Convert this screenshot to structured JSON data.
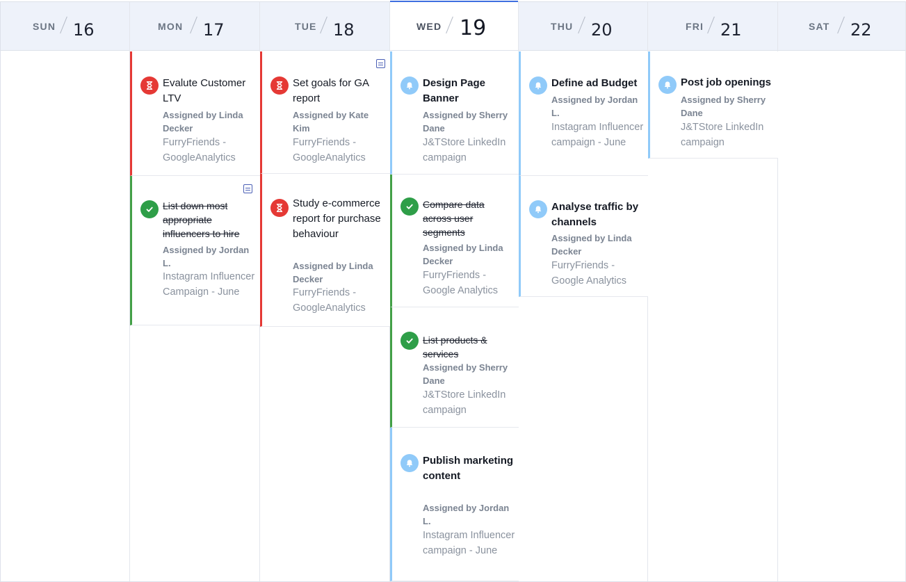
{
  "colors": {
    "overdue": "#e53935",
    "done": "#43a047",
    "reminder": "#90caf9",
    "today_accent": "#3f6fe0"
  },
  "days": [
    {
      "dow": "SUN",
      "num": "16"
    },
    {
      "dow": "MON",
      "num": "17"
    },
    {
      "dow": "TUE",
      "num": "18"
    },
    {
      "dow": "WED",
      "num": "19"
    },
    {
      "dow": "THU",
      "num": "20"
    },
    {
      "dow": "FRI",
      "num": "21"
    },
    {
      "dow": "SAT",
      "num": "22"
    }
  ],
  "tasks": {
    "mon_1": {
      "title": "Evalute Customer LTV",
      "assigned": "Assigned by Linda Decker",
      "project": "FurryFriends - GoogleAnalytics",
      "status": "overdue",
      "icon": "hourglass-icon"
    },
    "mon_2": {
      "title": "List down most appropriate influencers to hire",
      "assigned": "Assigned by Jordan L.",
      "project": "Instagram Influencer Campaign - June",
      "status": "done",
      "icon": "check-icon",
      "has_note": true
    },
    "tue_1": {
      "title": "Set goals for GA report",
      "assigned": "Assigned by Kate Kim",
      "project": "FurryFriends - GoogleAnalytics",
      "status": "overdue",
      "icon": "hourglass-icon",
      "has_note": true
    },
    "tue_2": {
      "title": "Study e-commerce report for purchase behaviour",
      "assigned": "Assigned by Linda Decker",
      "project": "FurryFriends - GoogleAnalytics",
      "status": "overdue",
      "icon": "hourglass-icon"
    },
    "wed_1": {
      "title": "Design Page Banner",
      "assigned": "Assigned by Sherry Dane",
      "project": "J&TStore LinkedIn campaign",
      "status": "reminder",
      "icon": "bell-icon"
    },
    "wed_2": {
      "title": "Compare data across user segments",
      "assigned": "Assigned by Linda Decker",
      "project": "FurryFriends - Google Analytics",
      "status": "done",
      "icon": "check-icon"
    },
    "wed_3": {
      "title": "List products & services",
      "assigned": "Assigned by Sherry Dane",
      "project": "J&TStore LinkedIn campaign",
      "status": "done",
      "icon": "check-icon"
    },
    "wed_4": {
      "title": "Publish marketing content",
      "assigned": "Assigned by Jordan L.",
      "project": "Instagram Influencer campaign - June",
      "status": "reminder",
      "icon": "bell-icon"
    },
    "thu_1": {
      "title": "Define ad Budget",
      "assigned": "Assigned by Jordan L.",
      "project": "Instagram Influencer campaign - June",
      "status": "reminder",
      "icon": "bell-icon"
    },
    "thu_2": {
      "title": "Analyse traffic by channels",
      "assigned": "Assigned by Linda Decker",
      "project": "FurryFriends - Google Analytics",
      "status": "reminder",
      "icon": "bell-icon"
    },
    "fri_1": {
      "title": "Post job openings",
      "assigned": "Assigned by Sherry Dane",
      "project": "J&TStore LinkedIn campaign",
      "status": "reminder",
      "icon": "bell-icon"
    }
  }
}
